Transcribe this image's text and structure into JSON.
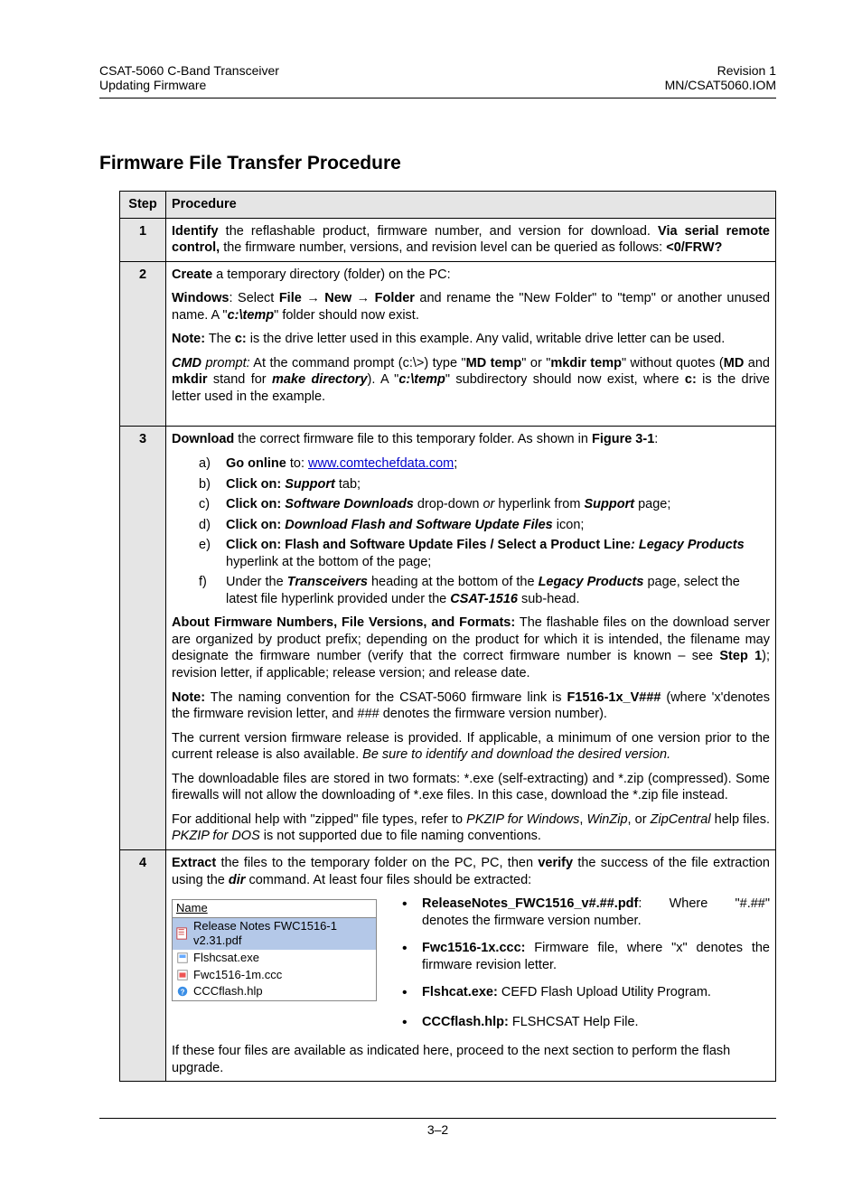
{
  "hdr": {
    "left1": "CSAT-5060 C-Band Transceiver",
    "left2": "Updating Firmware",
    "right1": "Revision 1",
    "right2": "MN/CSAT5060.IOM"
  },
  "title": "Firmware File Transfer Procedure",
  "table": {
    "colStep": "Step",
    "colProc": "Procedure",
    "r1": {
      "n": "1",
      "p1a": "Identify",
      "p1b": " the reflashable product, firmware number, and version for download. ",
      "p1c": "Via serial remote control,",
      "p1d": " the firmware number, versions, and revision level can be queried as follows: ",
      "p1e": "<0/FRW?"
    },
    "r2": {
      "n": "2",
      "p1a": "Create",
      "p1b": " a temporary directory (folder) on the PC:",
      "p2a": "Windows",
      "p2b": ": Select ",
      "p2c": "File ",
      "arrow1": "→",
      "p2d": " New ",
      "arrow2": "→",
      "p2e": " Folder",
      "p2f": " and rename the \"New Folder\" to \"temp\" or another unused name. A \"",
      "p2g": "c:\\temp",
      "p2h": "\" folder should now exist.",
      "p3a": "Note:",
      "p3b": " The ",
      "p3c": "c:",
      "p3d": " is the drive letter used in this example. Any valid, writable drive letter can be used.",
      "p4a": "CMD",
      "p4b": " prompt:",
      "p4c": " At the command prompt (c:\\>) type \"",
      "p4d": "MD temp",
      "p4e": "\" or \"",
      "p4f": "mkdir temp",
      "p4g": "\" without quotes (",
      "p4h": "MD",
      "p4i": " and ",
      "p4j": "mkdir",
      "p4k": " stand for ",
      "p4l": "make directory",
      "p4m": ").  A \"",
      "p4n": "c:\\temp",
      "p4o": "\" subdirectory should now exist, where ",
      "p4p": "c:",
      "p4q": " is the drive letter used in the example."
    },
    "r3": {
      "n": "3",
      "p1a": "Download",
      "p1b": " the correct firmware file to this temporary folder. As shown in ",
      "p1c": "Figure 3-1",
      "p1d": ":",
      "a_l": "a)",
      "a1": "Go online",
      "a2": " to: ",
      "a3": "www.comtechefdata.com",
      "a4": ";",
      "b_l": "b)",
      "b1": "Click on:",
      "b2": " Support ",
      "b3": "tab;",
      "c_l": "c)",
      "c1": "Click on:",
      "c2": " Software Downloads",
      "c3": " drop-down ",
      "c4": "or ",
      "c5": "hyperlink from ",
      "c6": "Support ",
      "c7": "page;",
      "d_l": "d)",
      "d1": "Click on:",
      "d2": " Download Flash and Software Update Files",
      "d3": " icon;",
      "e_l": "e)",
      "e1": "Click on: Flash and Software Update Files / Select a Product Line",
      "e2": ": Legacy Products",
      "e3": " hyperlink at the bottom of the page;",
      "f_l": "f)",
      "f1": "Under the ",
      "f2": "Transceivers",
      "f3": " heading at the bottom of the ",
      "f4": "Legacy Products",
      "f5": " page, select the latest file hyperlink provided under the ",
      "f6": "CSAT-1516",
      "f7": " sub-head.",
      "p2a": "About Firmware Numbers, File Versions, and Formats:",
      "p2b": " The flashable files on the download server are organized by product prefix; depending on the product for which it is intended, the filename may designate the firmware number (verify that the correct firmware number is known – see ",
      "p2c": "Step 1",
      "p2d": "); revision letter, if applicable; release version; and release date.",
      "p3a": "Note:",
      "p3b": " The naming convention for the CSAT-5060 firmware link is ",
      "p3c": "F1516-1x_V###",
      "p3d": " (where 'x'denotes the firmware revision letter, and ### denotes the firmware version number).",
      "p4": "The current version firmware release is provided. If applicable, a minimum of one version prior to the current release is also available. ",
      "p4i": "Be sure to identify and download the desired version.",
      "p5": "The downloadable files are stored in two formats: *.exe (self-extracting) and *.zip (compressed). Some firewalls will not allow the downloading of *.exe files. In this case, download the *.zip file instead.",
      "p6a": "For additional help with \"zipped\" file types, refer to ",
      "p6b": "PKZIP for Windows",
      "p6c": ", ",
      "p6d": "WinZip",
      "p6e": ", or ",
      "p6f": "ZipCentral",
      "p6g": " help files. ",
      "p6h": "PKZIP for DOS",
      "p6i": " is not supported due to file naming conventions."
    },
    "r4": {
      "n": "4",
      "p1a": "Extract",
      "p1b": " the files to the temporary folder on the PC, PC, then ",
      "p1c": "verify",
      "p1d": " the success of the file extraction using the ",
      "p1e": "dir",
      "p1f": " command. At least four files should be extracted:",
      "fbHdr": "Name",
      "fb1": "Release Notes FWC1516-1 v2.31.pdf",
      "fb2": "Flshcsat.exe",
      "fb3": "Fwc1516-1m.ccc",
      "fb4": "CCCflash.hlp",
      "bl1a": "ReleaseNotes_FWC1516_v#.##.pdf",
      "bl1b": ": Where \"#.##\" denotes the firmware version number.",
      "bl2a": "Fwc1516-1x.ccc:",
      "bl2b": " Firmware file, where \"x\" denotes the firmware revision letter.",
      "bl3a": "Flshcat.exe:",
      "bl3b": " CEFD Flash Upload Utility Program.",
      "bl4a": "CCCflash.hlp:",
      "bl4b": " FLSHCSAT Help File.",
      "pF": "If these four files are available as indicated here, proceed to the next section to perform the flash upgrade."
    }
  },
  "footer": "3–2"
}
